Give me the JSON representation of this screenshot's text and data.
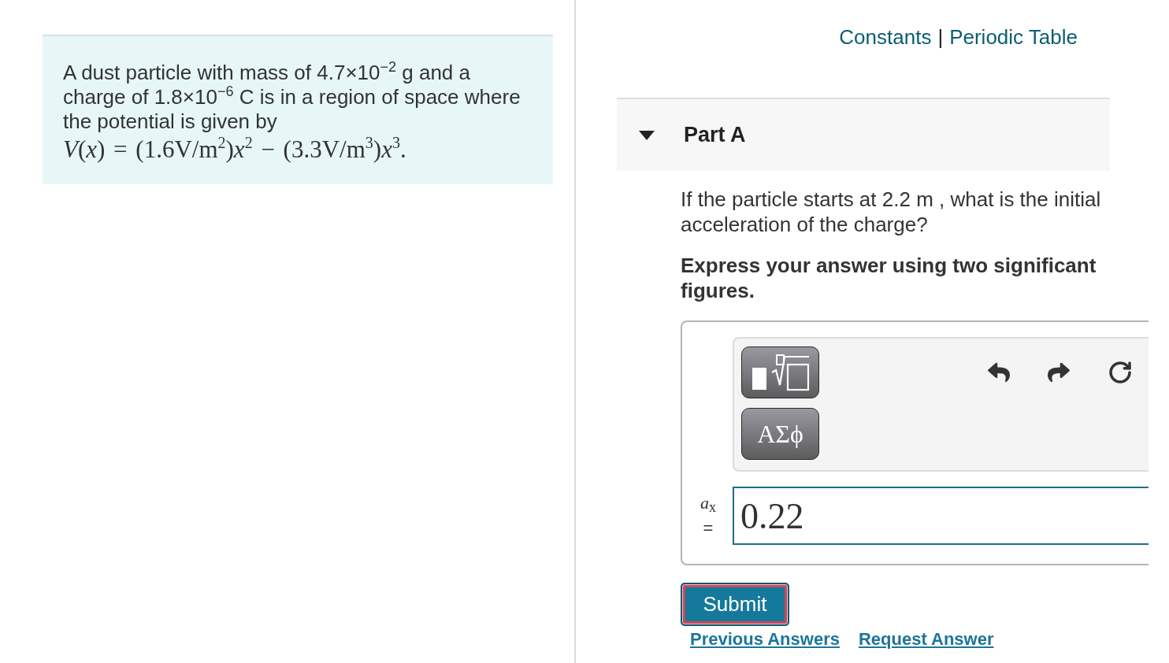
{
  "problem": {
    "statement": "A dust particle with mass of 4.7×10$^{−2}$ g and a charge of 1.8×10$^{−6}$ C is in a region of space where the potential is given by",
    "formula": "*V*(*x*) = (1.6V/m$^{2}$)*x*$^{2}$ − (3.3V/m$^{3}$)*x*$^{3}$."
  },
  "header_links": {
    "items": [
      "Constants",
      "Periodic Table"
    ],
    "separator": "|"
  },
  "part": {
    "title": "Part A",
    "expanded": true,
    "question": "If the particle starts at 2.2 m , what is the initial acceleration of the charge?",
    "instruction": "Express your answer using two significant figures.",
    "toolbar": {
      "symbols_button": "ΑΣϕ"
    },
    "answer": {
      "variable": "*a*$_{x}$",
      "equals": "=",
      "value": "0.22"
    },
    "submit": {
      "label": "Submit",
      "focused": true
    },
    "links": [
      "Previous Answers",
      "Request Answer"
    ]
  }
}
